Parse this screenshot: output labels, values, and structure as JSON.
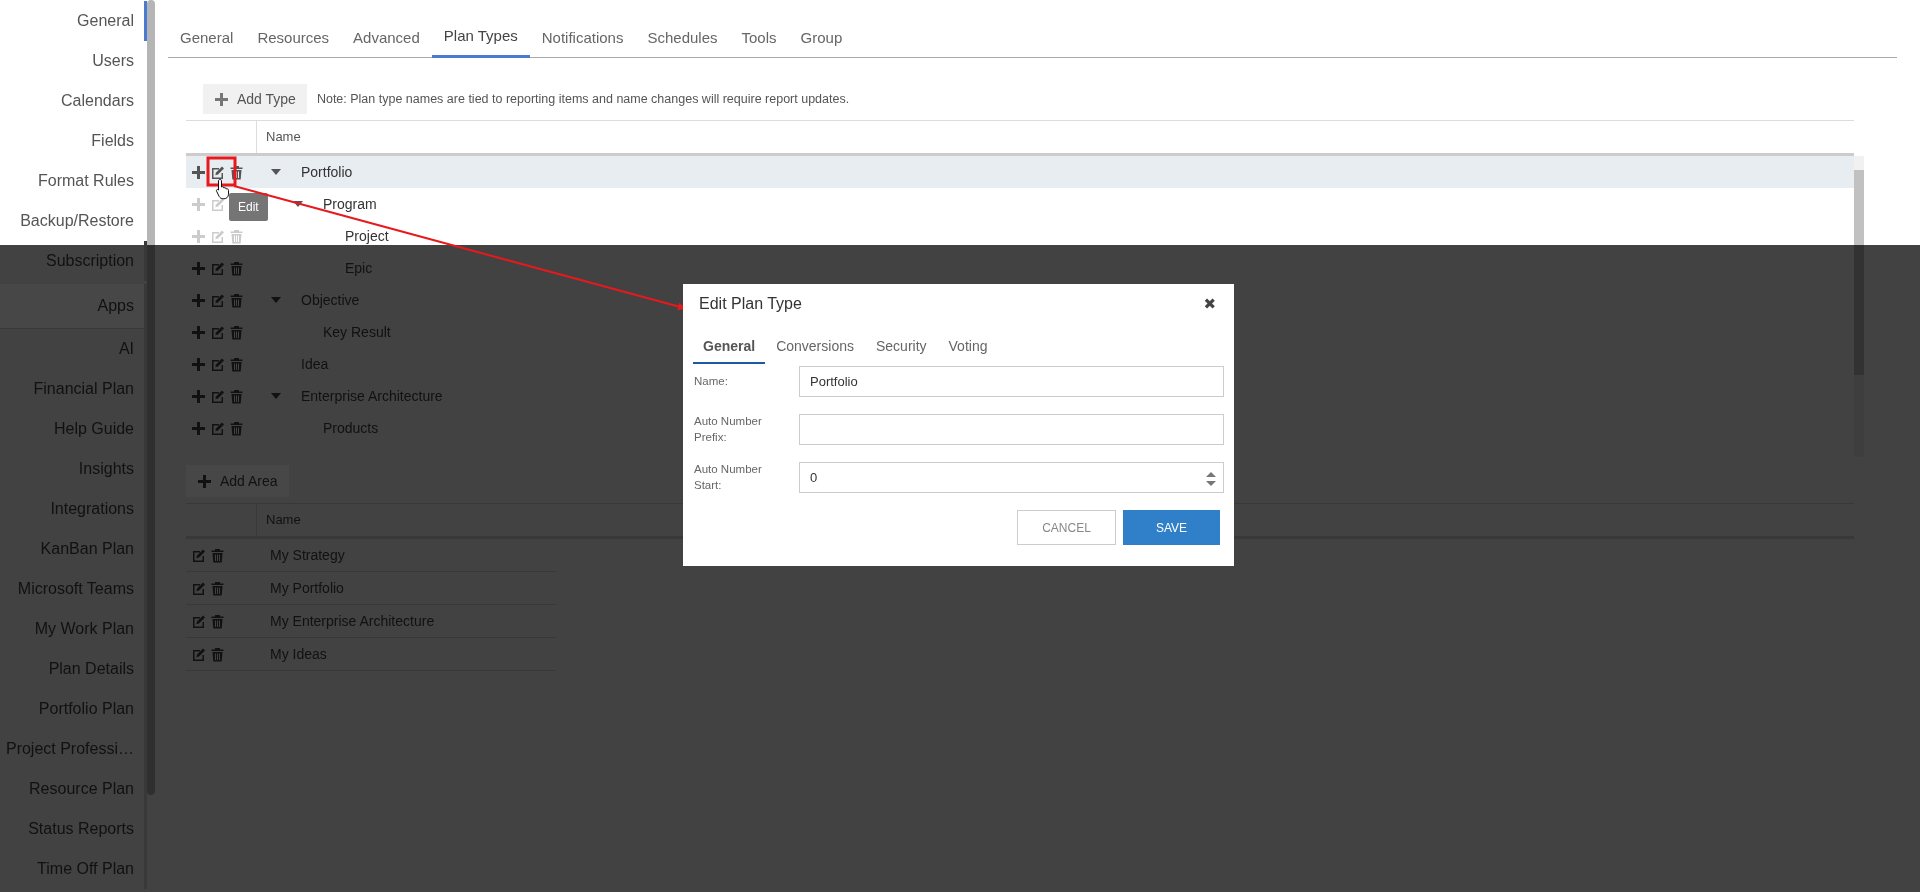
{
  "sidebar": {
    "items": [
      {
        "label": "General",
        "kind": "item",
        "selected": true
      },
      {
        "label": "Users",
        "kind": "item",
        "selected": false
      },
      {
        "label": "Calendars",
        "kind": "item",
        "selected": false
      },
      {
        "label": "Fields",
        "kind": "item",
        "selected": false
      },
      {
        "label": "Format Rules",
        "kind": "item",
        "selected": false
      },
      {
        "label": "Backup/Restore",
        "kind": "item",
        "selected": false
      },
      {
        "label": "Subscription",
        "kind": "item",
        "selected": false
      },
      {
        "label": "Apps",
        "kind": "header",
        "selected": false
      },
      {
        "label": "AI",
        "kind": "item",
        "selected": false
      },
      {
        "label": "Financial Plan",
        "kind": "item",
        "selected": false
      },
      {
        "label": "Help Guide",
        "kind": "item",
        "selected": false
      },
      {
        "label": "Insights",
        "kind": "item",
        "selected": false
      },
      {
        "label": "Integrations",
        "kind": "item",
        "selected": false
      },
      {
        "label": "KanBan Plan",
        "kind": "item",
        "selected": false
      },
      {
        "label": "Microsoft Teams",
        "kind": "item",
        "selected": false
      },
      {
        "label": "My Work Plan",
        "kind": "item",
        "selected": false
      },
      {
        "label": "Plan Details",
        "kind": "item",
        "selected": false
      },
      {
        "label": "Portfolio Plan",
        "kind": "item",
        "selected": false
      },
      {
        "label": "Project Professi…",
        "kind": "item",
        "selected": false
      },
      {
        "label": "Resource Plan",
        "kind": "item",
        "selected": false
      },
      {
        "label": "Status Reports",
        "kind": "item",
        "selected": false
      },
      {
        "label": "Time Off Plan",
        "kind": "item",
        "selected": false
      }
    ]
  },
  "tabs": [
    {
      "label": "General",
      "selected": false
    },
    {
      "label": "Resources",
      "selected": false
    },
    {
      "label": "Advanced",
      "selected": false
    },
    {
      "label": "Plan Types",
      "selected": true
    },
    {
      "label": "Notifications",
      "selected": false
    },
    {
      "label": "Schedules",
      "selected": false
    },
    {
      "label": "Tools",
      "selected": false
    },
    {
      "label": "Group",
      "selected": false
    }
  ],
  "plan_types": {
    "add_button": "Add Type",
    "note": "Note: Plan type names are tied to reporting items and name changes will require report updates.",
    "columns": [
      "Name"
    ],
    "tooltip": "Edit",
    "rows": [
      {
        "name": "Portfolio",
        "expanded": true,
        "selected": true,
        "children": [
          {
            "name": "Program",
            "expanded": true,
            "selected": false,
            "children": [
              {
                "name": "Project",
                "selected": false
              },
              {
                "name": "Epic",
                "selected": false
              }
            ]
          }
        ]
      },
      {
        "name": "Objective",
        "expanded": true,
        "selected": false,
        "children": [
          {
            "name": "Key Result",
            "selected": false
          }
        ]
      },
      {
        "name": "Idea",
        "selected": false
      },
      {
        "name": "Enterprise Architecture",
        "expanded": true,
        "selected": false,
        "children": [
          {
            "name": "Products",
            "selected": false
          }
        ]
      }
    ]
  },
  "areas": {
    "add_button": "Add Area",
    "columns": [
      "Name"
    ],
    "rows": [
      {
        "name": "My Strategy"
      },
      {
        "name": "My Portfolio"
      },
      {
        "name": "My Enterprise Architecture"
      },
      {
        "name": "My Ideas"
      }
    ]
  },
  "dialog": {
    "title": "Edit Plan Type",
    "close": "✖",
    "tabs": [
      {
        "label": "General",
        "selected": true
      },
      {
        "label": "Conversions",
        "selected": false
      },
      {
        "label": "Security",
        "selected": false
      },
      {
        "label": "Voting",
        "selected": false
      }
    ],
    "fields": [
      {
        "label": "Name:",
        "value": "Portfolio",
        "kind": "text"
      },
      {
        "label": "Auto Number Prefix:",
        "kind": "text"
      },
      {
        "label": "Auto Number Start:",
        "value": "0",
        "kind": "number"
      }
    ],
    "buttons": [
      {
        "label": "CANCEL",
        "kind": "secondary"
      },
      {
        "label": "SAVE",
        "kind": "primary"
      }
    ]
  }
}
